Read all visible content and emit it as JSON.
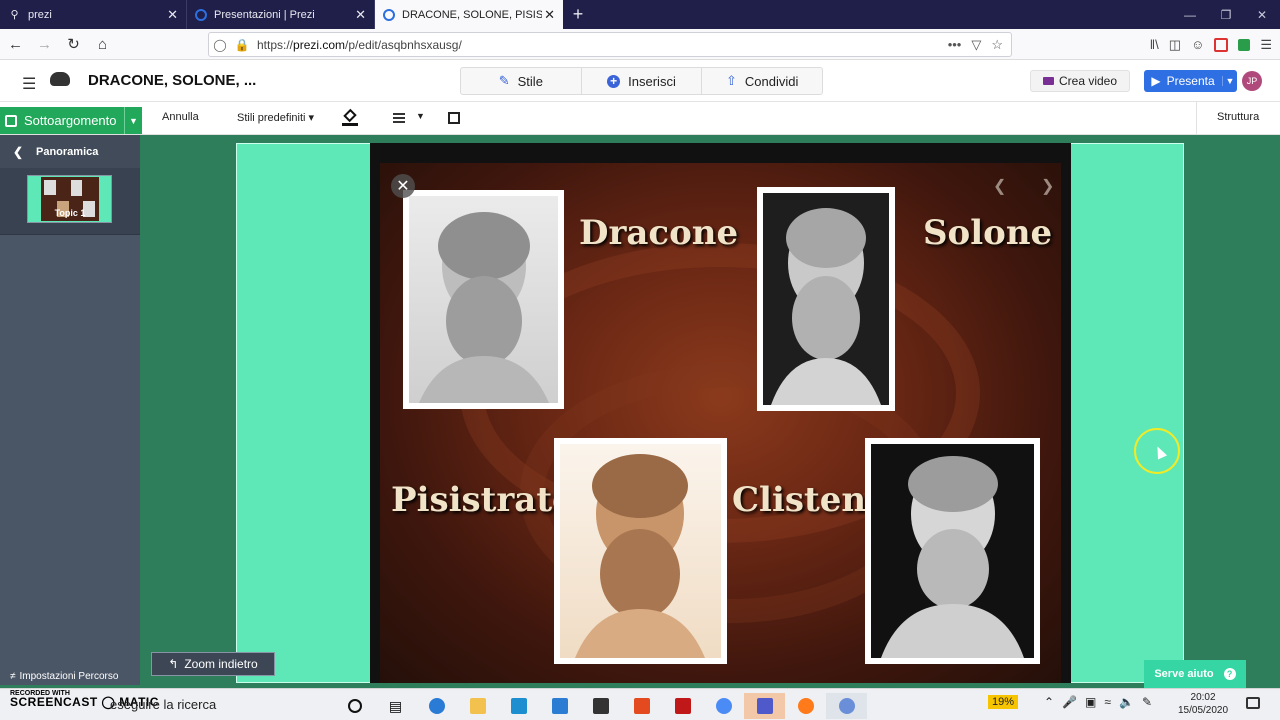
{
  "browser": {
    "tabs": [
      {
        "title": "prezi",
        "icon": "search-icon",
        "active": false
      },
      {
        "title": "Presentazioni | Prezi",
        "icon": "prezi-icon",
        "active": false
      },
      {
        "title": "DRACONE, SOLONE, PISISTRAT...",
        "icon": "prezi-icon",
        "active": true
      }
    ],
    "new_tab": "+",
    "url_prefix": "https://",
    "url_host": "prezi.com",
    "url_path": "/p/edit/asqbnhsxausg/"
  },
  "prezi": {
    "title": "DRACONE, SOLONE, ...",
    "tabs": [
      {
        "label": "Stile",
        "icon": "magic-wand-icon"
      },
      {
        "label": "Inserisci",
        "icon": "plus-circle-icon"
      },
      {
        "label": "Condividi",
        "icon": "share-icon"
      }
    ],
    "crea_video": "Crea video",
    "presenta": "Presenta",
    "avatar": "JP"
  },
  "toolbar": {
    "sottoargomento": "Sottoargomento",
    "annulla": "Annulla",
    "stili": "Stili predefiniti",
    "struttura": "Struttura"
  },
  "sidebar": {
    "panoramica": "Panoramica",
    "topic": "Topic 1",
    "impostazioni": "Impostazioni Percorso"
  },
  "slide": {
    "names": [
      "Dracone",
      "Solone",
      "Pisistrato",
      "Clistene"
    ]
  },
  "zoom_back": "Zoom indietro",
  "help": "Serve aiuto",
  "taskbar": {
    "recorded": "RECORDED WITH",
    "screencast": "SCREENCAST",
    "matic": "MATIC",
    "search": "eseguire la ricerca",
    "battery": "19%",
    "time": "20:02",
    "date": "15/05/2020"
  },
  "colors": {
    "frame": "#5ee8b8",
    "canvas": "#2e7d5b",
    "accent": "#2f6fe4",
    "sottoargomento": "#21a85a"
  }
}
